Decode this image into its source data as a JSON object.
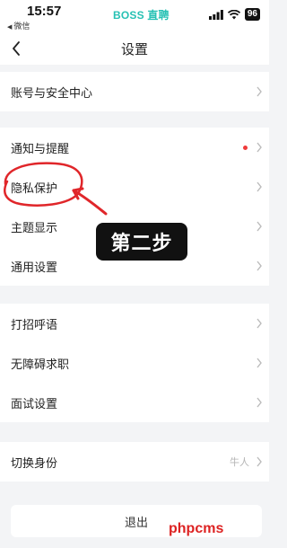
{
  "status_bar": {
    "time": "15:57",
    "back_app": "微信",
    "app_logo": "BOSS 直聘",
    "battery": "96",
    "icons": [
      "signal-icon",
      "wifi-icon",
      "battery-icon"
    ]
  },
  "header": {
    "title": "设置",
    "back_icon": "chevron-left-icon"
  },
  "settings": {
    "account": "账号与安全中心",
    "notifications": "通知与提醒",
    "privacy": "隐私保护",
    "theme": "主题显示",
    "general": "通用设置",
    "greeting": "打招呼语",
    "accessible_job": "无障碍求职",
    "interview": "面试设置",
    "switch_identity": "切换身份",
    "switch_identity_value": "牛人"
  },
  "logout_label": "退出",
  "annotation": {
    "step_label": "第二步",
    "highlight_color": "#e0262a"
  },
  "watermark": "phpcms",
  "colors": {
    "brand": "#27c1b4",
    "background": "#f3f4f6",
    "notification_dot": "#ef3b3b"
  }
}
